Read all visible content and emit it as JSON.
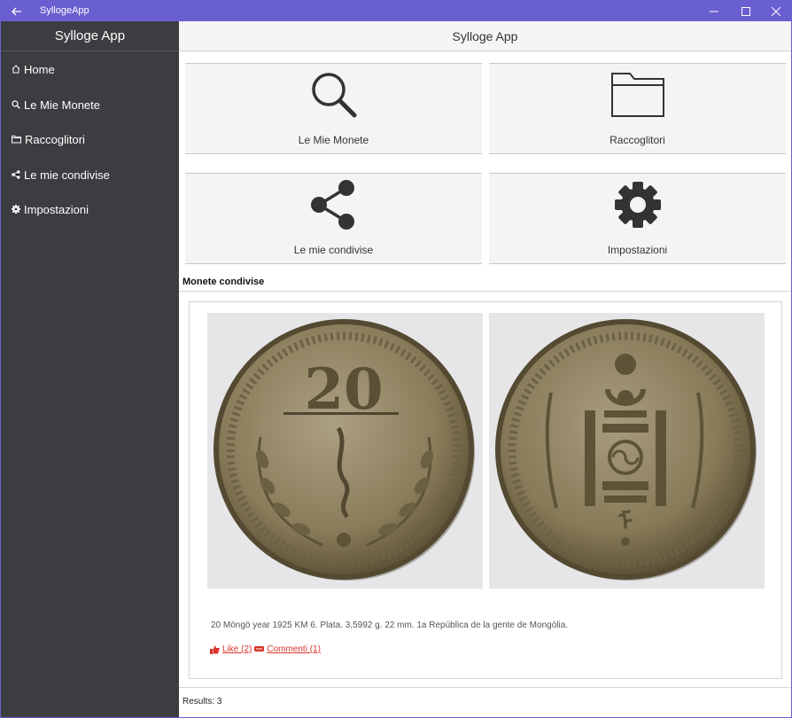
{
  "window": {
    "title": "SyllogeApp"
  },
  "sidebar": {
    "header": "Sylloge App",
    "items": [
      {
        "label": "Home",
        "icon": "home-icon"
      },
      {
        "label": "Le Mie Monete",
        "icon": "search-icon"
      },
      {
        "label": "Raccoglitori",
        "icon": "folder-icon"
      },
      {
        "label": "Le mie condivise",
        "icon": "share-icon"
      },
      {
        "label": "Impostazioni",
        "icon": "gear-icon"
      }
    ]
  },
  "main": {
    "header": "Sylloge App",
    "tiles": [
      {
        "label": "Le Mie Monete",
        "icon": "search-icon"
      },
      {
        "label": "Raccoglitori",
        "icon": "folder-icon"
      },
      {
        "label": "Le mie condivise",
        "icon": "share-icon"
      },
      {
        "label": "Impostazioni",
        "icon": "gear-icon"
      }
    ],
    "section_title": "Monete condivise",
    "coin": {
      "description": "20 Möngö year 1925 KM 6. Plata. 3,5992 g. 22 mm. 1a República de la gente de Mongòlia.",
      "obverse_text": "20",
      "like_label": "Like (2)",
      "comments_label": "Commenti (1)"
    },
    "results": "Results: 3"
  },
  "colors": {
    "titlebar": "#6a5fd0",
    "sidebar": "#3b3d40",
    "link": "#d9342b",
    "tile": "#f4f4f4"
  }
}
